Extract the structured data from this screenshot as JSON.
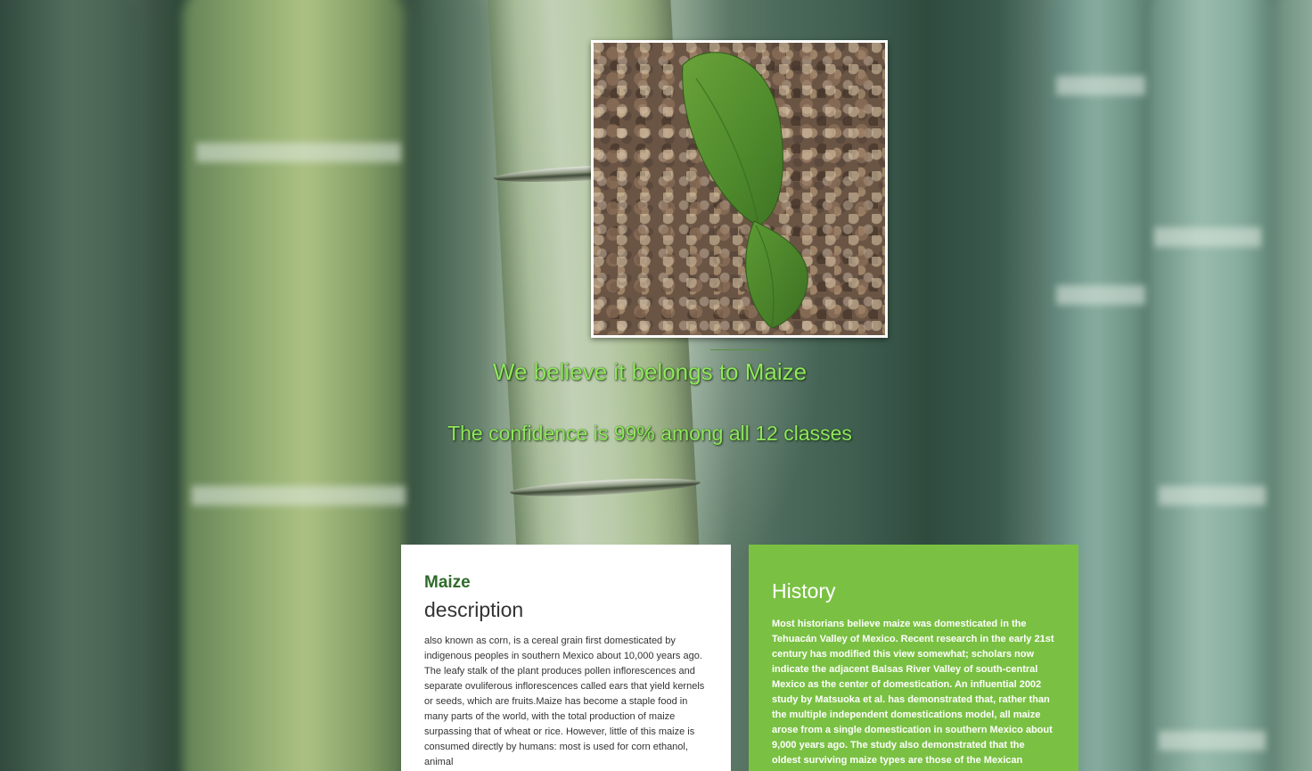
{
  "result": {
    "prediction_text": "We believe it belongs to Maize",
    "confidence_text": "The confidence is 99% among all 12 classes",
    "text_color": "#8fe85c"
  },
  "uploaded_image": {
    "alt": "plant seedling photo"
  },
  "description_card": {
    "plant_name": "Maize",
    "heading": "description",
    "body": "also known as corn, is a cereal grain first domesticated by indigenous peoples in southern Mexico about 10,000 years ago. The leafy stalk of the plant produces pollen inflorescences and separate ovuliferous inflorescences called ears that yield kernels or seeds, which are fruits.Maize has become a staple food in many parts of the world, with the total production of maize surpassing that of wheat or rice. However, little of this maize is consumed directly by humans: most is used for corn ethanol, animal",
    "background": "#ffffff",
    "name_color": "#2f6b2a"
  },
  "history_card": {
    "heading": "History",
    "body": "Most historians believe maize was domesticated in the Tehuacán Valley of Mexico. Recent research in the early 21st century has modified this view somewhat; scholars now indicate the adjacent Balsas River Valley of south-central Mexico as the center of domestication. An influential 2002 study by Matsuoka et al. has demonstrated that, rather than the multiple independent domestications model, all maize arose from a single domestication in southern Mexico about 9,000 years ago. The study also demonstrated that the oldest surviving maize types are those of the Mexican",
    "background": "#7ac143"
  }
}
